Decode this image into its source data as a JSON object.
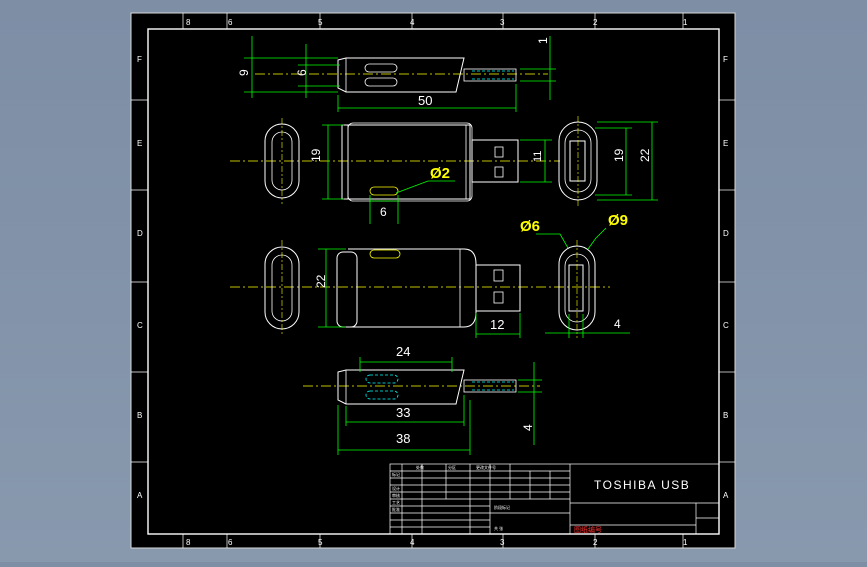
{
  "drawing": {
    "title": "TOSHIBA USB",
    "red_note": "图纸编号",
    "colors": {
      "background": "#000000",
      "frame": "#ffffff",
      "dimension": "#00ff00",
      "callout": "#ffff00",
      "centerline": "#ffff00",
      "hidden": "#00ffff",
      "note_red": "#ff3030"
    },
    "zone_columns": [
      "8",
      "6",
      "5",
      "4",
      "3",
      "2",
      "1"
    ],
    "zone_rows": [
      "F",
      "E",
      "D",
      "C",
      "B",
      "A"
    ]
  },
  "dimensions": {
    "top_view": {
      "height_9": "9",
      "height_6": "6",
      "height_1": "1",
      "length_50": "50"
    },
    "front_view": {
      "height_19": "19",
      "pin_11": "11",
      "hole_dia": "Ø2",
      "hole_spacing": "6"
    },
    "end_view_right": {
      "height_19": "19",
      "height_22": "22"
    },
    "section_view": {
      "height_22": "22",
      "plug_12": "12"
    },
    "end_view_lower": {
      "dia_6": "Ø6",
      "dia_9": "Ø9",
      "offset_4": "4"
    },
    "bottom_view": {
      "length_24": "24",
      "length_33": "33",
      "length_38": "38",
      "height_4": "4"
    }
  },
  "title_block": {
    "row_labels": [
      "标记",
      "设计",
      "审核",
      "工艺",
      "批准"
    ],
    "header_labels": [
      "处数",
      "分区",
      "更改文件号"
    ],
    "small_notes": [
      "阶段标记",
      "共  张"
    ]
  }
}
